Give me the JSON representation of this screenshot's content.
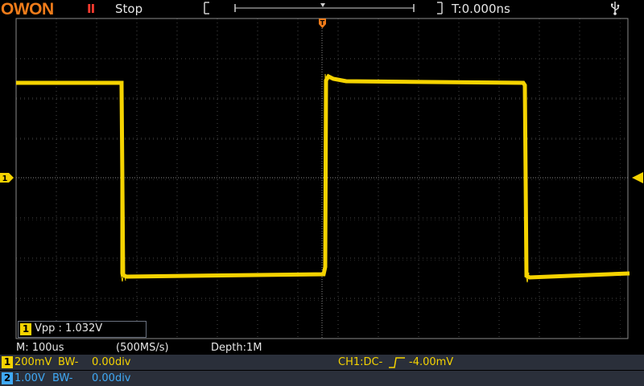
{
  "brand": "OWON",
  "header": {
    "run_state": "Stop",
    "trigger_time": "T:0.000ns",
    "trigger_marker": "T"
  },
  "timebase": {
    "label": "M: 100us",
    "sample_rate": "(500MS/s)",
    "depth": "Depth:1M"
  },
  "measurement": {
    "channel": "1",
    "text": "Vpp : 1.032V"
  },
  "channels": [
    {
      "num": "1",
      "vdiv": "200mV",
      "bw": "BW-",
      "offset": "0.00div",
      "color": "#f5d300"
    },
    {
      "num": "2",
      "vdiv": "1.00V",
      "bw": "BW-",
      "offset": "0.00div",
      "color": "#3fa9f5"
    }
  ],
  "trigger": {
    "source": "CH1:DC-",
    "level": "-4.00mV"
  },
  "colors": {
    "ch1": "#f5d300",
    "ch2": "#3fa9f5",
    "trigger_marker": "#f07c1a",
    "grid": "#555555",
    "accent": "#f07c1a"
  },
  "icons": [
    "owon-logo",
    "pause-icon",
    "usb-icon",
    "trigger-marker-icon",
    "ch1-ground-marker-icon",
    "trigger-level-marker-icon"
  ]
}
